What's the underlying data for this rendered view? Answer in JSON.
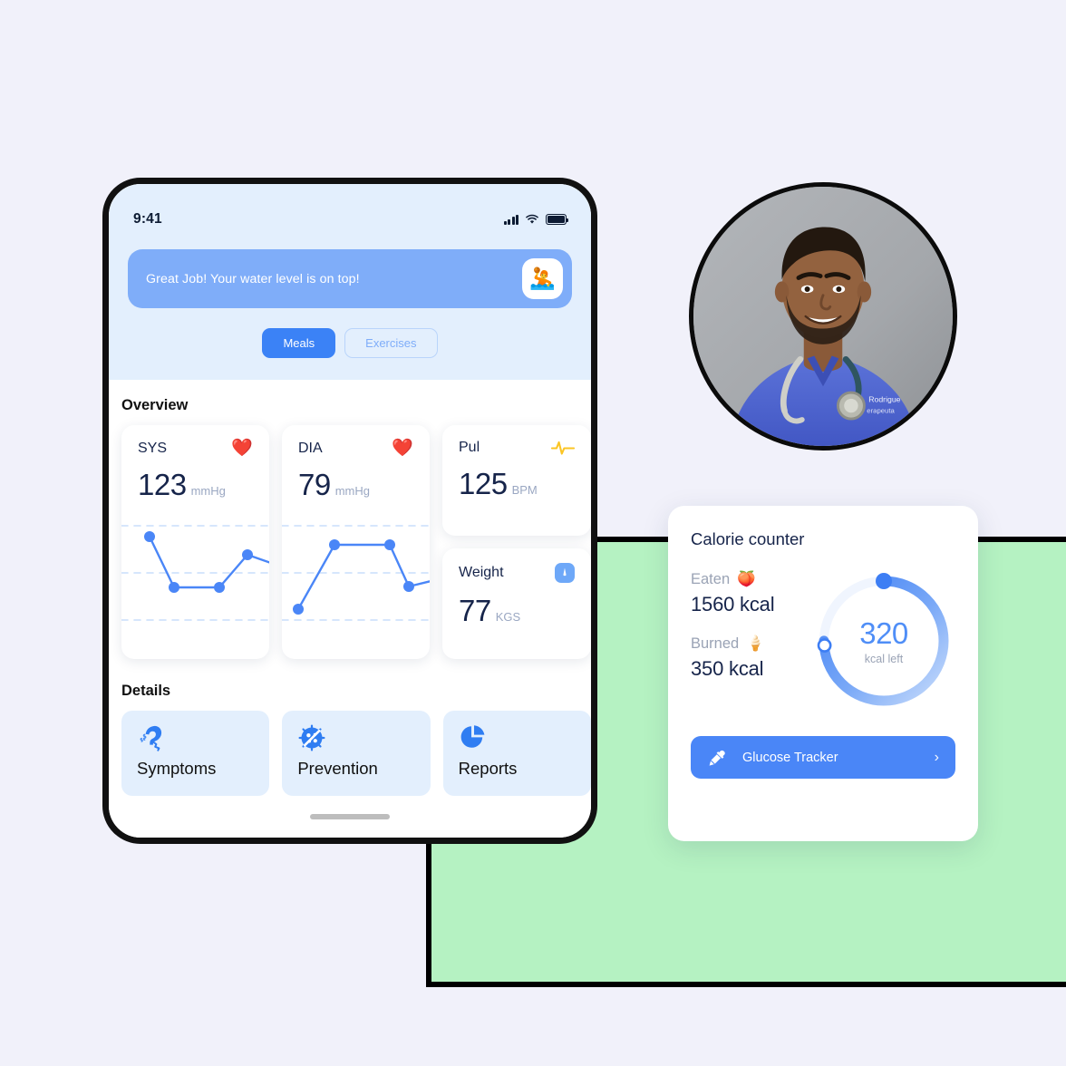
{
  "page": {
    "background_color": "#f1f1fa",
    "green_panel_color": "#b5f2c2"
  },
  "phone": {
    "status_bar": {
      "time": "9:41",
      "signal_icon": "cellular-bars-icon",
      "wifi_icon": "wifi-icon",
      "battery_icon": "battery-icon"
    },
    "banner": {
      "message": "Great Job! Your water level is on top!",
      "badge_icon": "water-person-icon",
      "badge_emoji": "🤽",
      "background_color": "#7fadf9"
    },
    "segmented": {
      "options": [
        {
          "label": "Meals",
          "active": true
        },
        {
          "label": "Exercises",
          "active": false
        }
      ]
    },
    "overview": {
      "title": "Overview",
      "cards": [
        {
          "label": "SYS",
          "value": "123",
          "unit": "mmHg",
          "icon": "heart-icon",
          "emoji": "❤️"
        },
        {
          "label": "DIA",
          "value": "79",
          "unit": "mmHg",
          "icon": "heart-icon",
          "emoji": "❤️"
        },
        {
          "label": "Pul",
          "value": "125",
          "unit": "BPM",
          "icon": "pulse-wave-icon"
        },
        {
          "label": "Weight",
          "value": "77",
          "unit": "KGS",
          "icon": "weight-gauge-icon"
        }
      ]
    },
    "details": {
      "title": "Details",
      "items": [
        {
          "label": "Symptoms",
          "icon": "sneezing-person-icon"
        },
        {
          "label": "Prevention",
          "icon": "no-virus-icon"
        },
        {
          "label": "Reports",
          "icon": "pie-chart-icon"
        }
      ]
    },
    "home_indicator": "home-indicator"
  },
  "avatar": {
    "alt": "doctor-portrait",
    "border_color": "#0b0b0b"
  },
  "calorie": {
    "title": "Calorie counter",
    "stats": [
      {
        "label": "Eaten",
        "emoji": "🍑",
        "value": "1560 kcal"
      },
      {
        "label": "Burned",
        "emoji": "🍦",
        "value": "350 kcal"
      }
    ],
    "ring": {
      "value": "320",
      "caption": "kcal left",
      "accent_color": "#4a86f7"
    },
    "button": {
      "label": "Glucose Tracker",
      "icon": "dropper-icon",
      "chevron": "›",
      "background_color": "#4a86f7"
    }
  },
  "chart_data": [
    {
      "type": "line",
      "title": "SYS",
      "ylabel": "mmHg",
      "x": [
        0,
        1,
        2,
        3,
        4
      ],
      "values": [
        128,
        112,
        112,
        120,
        117
      ],
      "ylim": [
        100,
        135
      ],
      "grid": true,
      "gridlines": [
        131,
        116,
        102
      ],
      "series_color": "#4a86f7"
    },
    {
      "type": "line",
      "title": "DIA",
      "ylabel": "mmHg",
      "x": [
        0,
        1,
        2,
        3,
        4
      ],
      "values": [
        70,
        88,
        88,
        76,
        78
      ],
      "ylim": [
        65,
        92
      ],
      "grid": true,
      "gridlines": [
        90,
        77,
        67
      ],
      "series_color": "#4a86f7"
    },
    {
      "type": "donut",
      "title": "Calorie counter",
      "categories": [
        "consumed",
        "remaining"
      ],
      "values": [
        75,
        25
      ],
      "center_value": 320,
      "center_label": "kcal left",
      "eaten_kcal": 1560,
      "burned_kcal": 350,
      "series_color": "#4a86f7"
    }
  ]
}
